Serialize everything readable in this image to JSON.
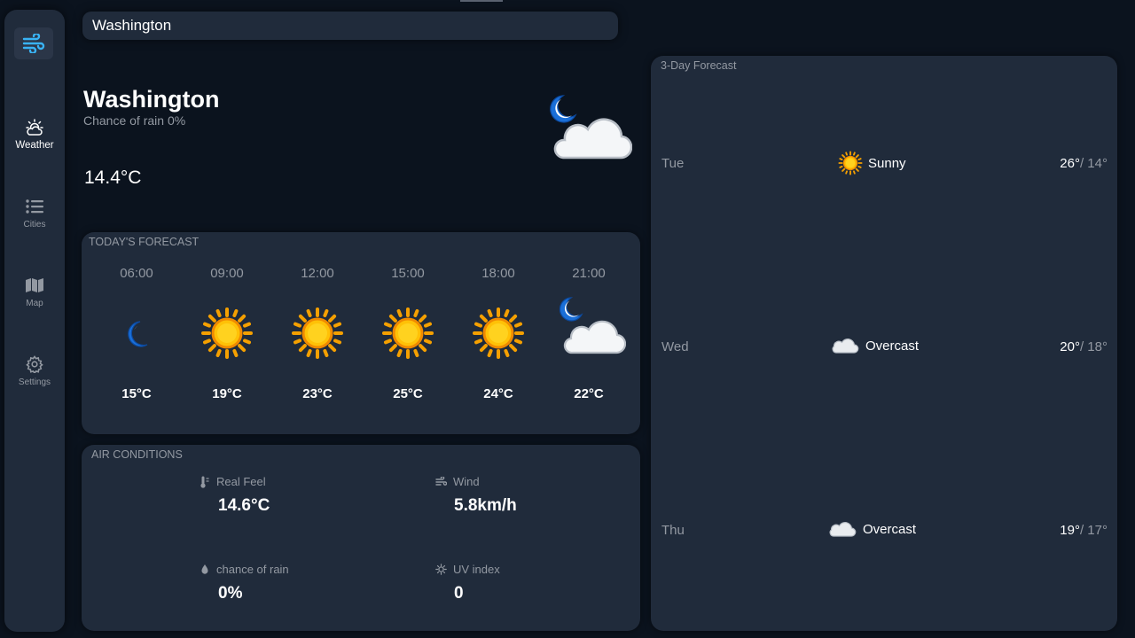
{
  "search": {
    "value": "Washington"
  },
  "sidebar": {
    "items": [
      {
        "label": "Weather",
        "icon": "cloud-sun-icon",
        "active": true
      },
      {
        "label": "Cities",
        "icon": "list-icon",
        "active": false
      },
      {
        "label": "Map",
        "icon": "map-icon",
        "active": false
      },
      {
        "label": "Settings",
        "icon": "gear-icon",
        "active": false
      }
    ]
  },
  "current": {
    "city": "Washington",
    "rain_chance": "Chance of rain 0%",
    "temperature": "14.4°C",
    "icon": "moon-cloud-icon"
  },
  "today": {
    "title": "TODAY'S FORECAST",
    "hours": [
      {
        "time": "06:00",
        "temp": "15°C",
        "icon": "moon-icon"
      },
      {
        "time": "09:00",
        "temp": "19°C",
        "icon": "sun-icon"
      },
      {
        "time": "12:00",
        "temp": "23°C",
        "icon": "sun-icon"
      },
      {
        "time": "15:00",
        "temp": "25°C",
        "icon": "sun-icon"
      },
      {
        "time": "18:00",
        "temp": "24°C",
        "icon": "sun-icon"
      },
      {
        "time": "21:00",
        "temp": "22°C",
        "icon": "moon-cloud-icon"
      }
    ]
  },
  "air": {
    "title": "AIR CONDITIONS",
    "real_feel": {
      "label": "Real Feel",
      "value": "14.6°C",
      "icon": "thermometer-icon"
    },
    "wind": {
      "label": "Wind",
      "value": "5.8km/h",
      "icon": "wind-icon"
    },
    "rain": {
      "label": "chance of rain",
      "value": "0%",
      "icon": "droplet-icon"
    },
    "uv": {
      "label": "UV index",
      "value": "0",
      "icon": "sun-small-icon"
    }
  },
  "forecast": {
    "title": "3-Day Forecast",
    "days": [
      {
        "day": "Tue",
        "condition": "Sunny",
        "high": "26°",
        "low": "/ 14°",
        "icon": "sun-icon"
      },
      {
        "day": "Wed",
        "condition": "Overcast",
        "high": "20°",
        "low": "/ 18°",
        "icon": "cloud-icon"
      },
      {
        "day": "Thu",
        "condition": "Overcast",
        "high": "19°",
        "low": "/ 17°",
        "icon": "cloud-icon"
      }
    ]
  },
  "colors": {
    "background": "#0b131e",
    "panel": "#202b3b",
    "muted_text": "#9399a2",
    "accent": "#0095ff",
    "sun": "#ffc107"
  }
}
